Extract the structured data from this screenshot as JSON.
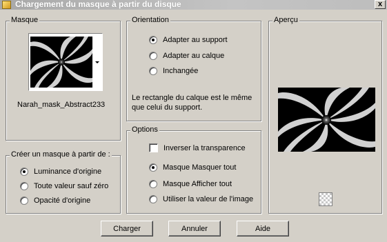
{
  "window": {
    "title": "Chargement du masque à partir du disque",
    "close_label": "x"
  },
  "mask_group": {
    "legend": "Masque",
    "mask_name": "Narah_mask_Abstract233"
  },
  "create_from_group": {
    "legend": "Créer un masque à partir de :",
    "options": [
      {
        "label": "Luminance d'origine",
        "selected": true
      },
      {
        "label": "Toute valeur sauf zéro",
        "selected": false
      },
      {
        "label": "Opacité d'origine",
        "selected": false
      }
    ]
  },
  "orientation_group": {
    "legend": "Orientation",
    "options": [
      {
        "label": "Adapter au support",
        "selected": true
      },
      {
        "label": "Adapter au calque",
        "selected": false
      },
      {
        "label": "Inchangée",
        "selected": false
      }
    ],
    "info_line1": "Le rectangle du calque est le même",
    "info_line2": "que celui du support."
  },
  "options_group": {
    "legend": "Options",
    "invert_label": "Inverser la transparence",
    "invert_checked": false,
    "options": [
      {
        "label": "Masque Masquer tout",
        "selected": true
      },
      {
        "label": "Masque Afficher tout",
        "selected": false
      },
      {
        "label": "Utiliser la valeur de l'image",
        "selected": false
      }
    ]
  },
  "preview_group": {
    "legend": "Aperçu"
  },
  "buttons": {
    "load": "Charger",
    "cancel": "Annuler",
    "help": "Aide"
  }
}
